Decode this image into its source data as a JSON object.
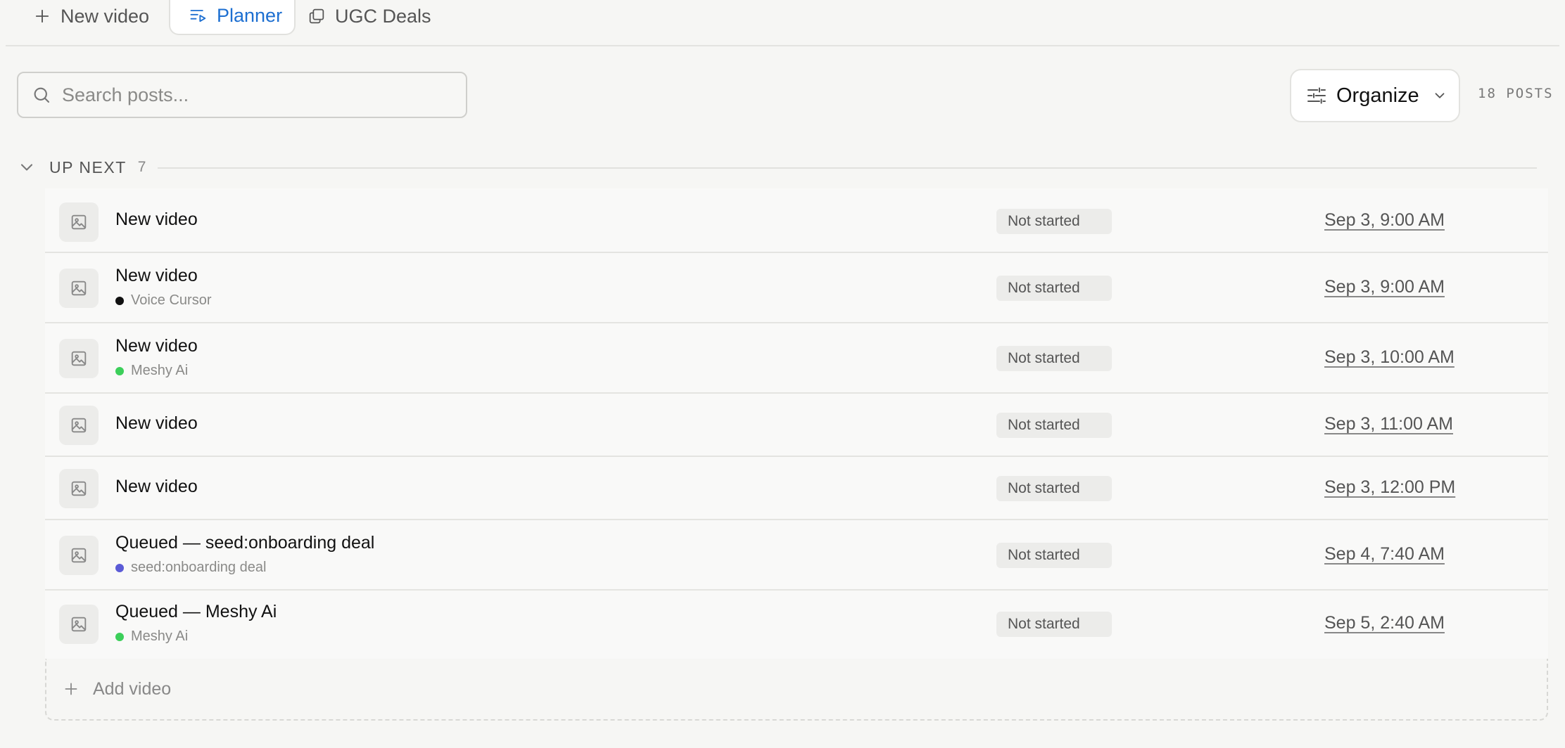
{
  "tabs": {
    "new_video": "New video",
    "planner": "Planner",
    "ugc_deals": "UGC Deals"
  },
  "search": {
    "placeholder": "Search posts..."
  },
  "organize": {
    "label": "Organize"
  },
  "post_count": "18 POSTS",
  "section": {
    "title": "UP NEXT",
    "count": "7"
  },
  "rows": [
    {
      "title": "New video",
      "tag": null,
      "status": "Not started",
      "date": "Sep 3, 9:00 AM"
    },
    {
      "title": "New video",
      "tag": "Voice Cursor",
      "tag_color": "#111111",
      "status": "Not started",
      "date": "Sep 3, 9:00 AM"
    },
    {
      "title": "New video",
      "tag": "Meshy Ai",
      "tag_color": "#3ccf5a",
      "status": "Not started",
      "date": "Sep 3, 10:00 AM"
    },
    {
      "title": "New video",
      "tag": null,
      "status": "Not started",
      "date": "Sep 3, 11:00 AM"
    },
    {
      "title": "New video",
      "tag": null,
      "status": "Not started",
      "date": "Sep 3, 12:00 PM"
    },
    {
      "title": "Queued — seed:onboarding deal",
      "tag": "seed:onboarding deal",
      "tag_color": "#5b5bd6",
      "status": "Not started",
      "date": "Sep 4, 7:40 AM"
    },
    {
      "title": "Queued — Meshy Ai",
      "tag": "Meshy Ai",
      "tag_color": "#3ccf5a",
      "status": "Not started",
      "date": "Sep 5, 2:40 AM"
    }
  ],
  "add_video": {
    "label": "Add video"
  },
  "colors": {
    "accent": "#1d6fd1",
    "background": "#f6f6f4"
  }
}
